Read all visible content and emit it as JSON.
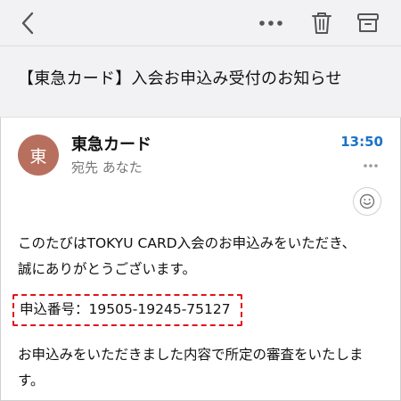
{
  "toolbar": {
    "back_icon": "chevron-left-icon",
    "more_icon": "more-horizontal-icon",
    "trash_icon": "trash-icon",
    "archive_icon": "archive-icon"
  },
  "email": {
    "subject": "【東急カード】入会お申込み受付のお知らせ",
    "avatar_letter": "東",
    "avatar_color": "#b8705e",
    "sender": "東急カード",
    "recipient_line": "宛先 あなた",
    "time": "13:50",
    "time_color": "#1a73c7",
    "body": {
      "line1": "このたびはTOKYU CARD入会のお申込みをいただき、",
      "line2": "誠にありがとうございます。",
      "application_number": "申込番号：19505-19245-75127",
      "line3": "お申込みをいただきました内容で所定の審査をいたしま",
      "line4": "す。"
    },
    "highlight_color": "#e0121b"
  }
}
